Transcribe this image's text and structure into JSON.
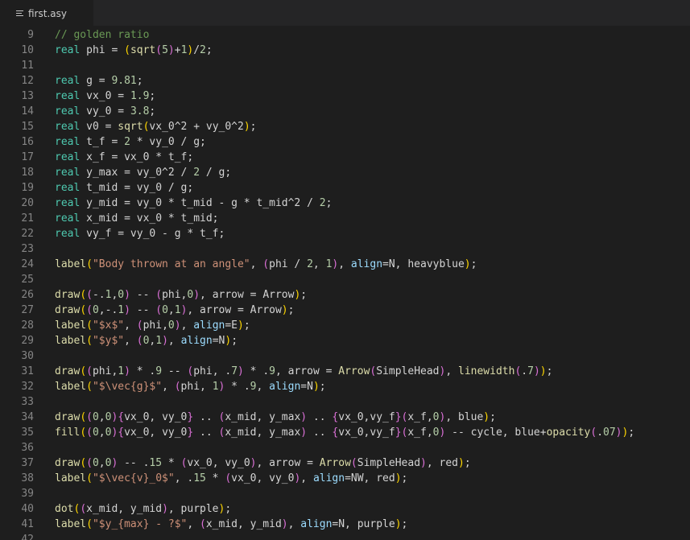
{
  "tab": {
    "filename": "first.asy",
    "icon": "lines-icon"
  },
  "lines": [
    {
      "n": "9",
      "t": [
        [
          "c",
          "// golden ratio"
        ]
      ]
    },
    {
      "n": "10",
      "t": [
        [
          "k",
          "real"
        ],
        [
          "",
          " phi = "
        ],
        [
          "p1",
          "("
        ],
        [
          "f",
          "sqrt"
        ],
        [
          "p2",
          "("
        ],
        [
          "n",
          "5"
        ],
        [
          "p2",
          ")"
        ],
        [
          "",
          "+"
        ],
        [
          "n",
          "1"
        ],
        [
          "p1",
          ")"
        ],
        [
          "",
          "/"
        ],
        [
          "n",
          "2"
        ],
        [
          "",
          ";"
        ]
      ]
    },
    {
      "n": "11",
      "t": []
    },
    {
      "n": "12",
      "t": [
        [
          "k",
          "real"
        ],
        [
          "",
          " g = "
        ],
        [
          "n",
          "9.81"
        ],
        [
          "",
          ";"
        ]
      ]
    },
    {
      "n": "13",
      "t": [
        [
          "k",
          "real"
        ],
        [
          "",
          " vx_0 = "
        ],
        [
          "n",
          "1.9"
        ],
        [
          "",
          ";"
        ]
      ]
    },
    {
      "n": "14",
      "t": [
        [
          "k",
          "real"
        ],
        [
          "",
          " vy_0 = "
        ],
        [
          "n",
          "3.8"
        ],
        [
          "",
          ";"
        ]
      ]
    },
    {
      "n": "15",
      "t": [
        [
          "k",
          "real"
        ],
        [
          "",
          " v0 = "
        ],
        [
          "f",
          "sqrt"
        ],
        [
          "p1",
          "("
        ],
        [
          "",
          "vx_0^2 + vy_0^2"
        ],
        [
          "p1",
          ")"
        ],
        [
          "",
          ";"
        ]
      ]
    },
    {
      "n": "16",
      "t": [
        [
          "k",
          "real"
        ],
        [
          "",
          " t_f = "
        ],
        [
          "n",
          "2"
        ],
        [
          "",
          " * vy_0 / g;"
        ]
      ]
    },
    {
      "n": "17",
      "t": [
        [
          "k",
          "real"
        ],
        [
          "",
          " x_f = vx_0 * t_f;"
        ]
      ]
    },
    {
      "n": "18",
      "t": [
        [
          "k",
          "real"
        ],
        [
          "",
          " y_max = vy_0^2 / "
        ],
        [
          "n",
          "2"
        ],
        [
          "",
          " / g;"
        ]
      ]
    },
    {
      "n": "19",
      "t": [
        [
          "k",
          "real"
        ],
        [
          "",
          " t_mid = vy_0 / g;"
        ]
      ]
    },
    {
      "n": "20",
      "t": [
        [
          "k",
          "real"
        ],
        [
          "",
          " y_mid = vy_0 * t_mid - g * t_mid^2 / "
        ],
        [
          "n",
          "2"
        ],
        [
          "",
          ";"
        ]
      ]
    },
    {
      "n": "21",
      "t": [
        [
          "k",
          "real"
        ],
        [
          "",
          " x_mid = vx_0 * t_mid;"
        ]
      ]
    },
    {
      "n": "22",
      "t": [
        [
          "k",
          "real"
        ],
        [
          "",
          " vy_f = vy_0 - g * t_f;"
        ]
      ]
    },
    {
      "n": "23",
      "t": []
    },
    {
      "n": "24",
      "t": [
        [
          "f",
          "label"
        ],
        [
          "p1",
          "("
        ],
        [
          "s",
          "\"Body thrown at an angle\""
        ],
        [
          "",
          ", "
        ],
        [
          "p2",
          "("
        ],
        [
          "",
          "phi / "
        ],
        [
          "n",
          "2"
        ],
        [
          "",
          ", "
        ],
        [
          "n",
          "1"
        ],
        [
          "p2",
          ")"
        ],
        [
          "",
          ", "
        ],
        [
          "a",
          "align"
        ],
        [
          "",
          "=N, heavyblue"
        ],
        [
          "p1",
          ")"
        ],
        [
          "",
          ";"
        ]
      ]
    },
    {
      "n": "25",
      "t": []
    },
    {
      "n": "26",
      "t": [
        [
          "f",
          "draw"
        ],
        [
          "p1",
          "("
        ],
        [
          "p2",
          "("
        ],
        [
          "",
          "-."
        ],
        [
          "n",
          "1"
        ],
        [
          "",
          ","
        ],
        [
          "n",
          "0"
        ],
        [
          "p2",
          ")"
        ],
        [
          "",
          " -- "
        ],
        [
          "p2",
          "("
        ],
        [
          "",
          "phi,"
        ],
        [
          "n",
          "0"
        ],
        [
          "p2",
          ")"
        ],
        [
          "",
          ", arrow = Arrow"
        ],
        [
          "p1",
          ")"
        ],
        [
          "",
          ";"
        ]
      ]
    },
    {
      "n": "27",
      "t": [
        [
          "f",
          "draw"
        ],
        [
          "p1",
          "("
        ],
        [
          "p2",
          "("
        ],
        [
          "n",
          "0"
        ],
        [
          "",
          ",-."
        ],
        [
          "n",
          "1"
        ],
        [
          "p2",
          ")"
        ],
        [
          "",
          " -- "
        ],
        [
          "p2",
          "("
        ],
        [
          "n",
          "0"
        ],
        [
          "",
          ","
        ],
        [
          "n",
          "1"
        ],
        [
          "p2",
          ")"
        ],
        [
          "",
          ", arrow = Arrow"
        ],
        [
          "p1",
          ")"
        ],
        [
          "",
          ";"
        ]
      ]
    },
    {
      "n": "28",
      "t": [
        [
          "f",
          "label"
        ],
        [
          "p1",
          "("
        ],
        [
          "s",
          "\"$x$\""
        ],
        [
          "",
          ", "
        ],
        [
          "p2",
          "("
        ],
        [
          "",
          "phi,"
        ],
        [
          "n",
          "0"
        ],
        [
          "p2",
          ")"
        ],
        [
          "",
          ", "
        ],
        [
          "a",
          "align"
        ],
        [
          "",
          "=E"
        ],
        [
          "p1",
          ")"
        ],
        [
          "",
          ";"
        ]
      ]
    },
    {
      "n": "29",
      "t": [
        [
          "f",
          "label"
        ],
        [
          "p1",
          "("
        ],
        [
          "s",
          "\"$y$\""
        ],
        [
          "",
          ", "
        ],
        [
          "p2",
          "("
        ],
        [
          "n",
          "0"
        ],
        [
          "",
          ","
        ],
        [
          "n",
          "1"
        ],
        [
          "p2",
          ")"
        ],
        [
          "",
          ", "
        ],
        [
          "a",
          "align"
        ],
        [
          "",
          "=N"
        ],
        [
          "p1",
          ")"
        ],
        [
          "",
          ";"
        ]
      ]
    },
    {
      "n": "30",
      "t": []
    },
    {
      "n": "31",
      "t": [
        [
          "f",
          "draw"
        ],
        [
          "p1",
          "("
        ],
        [
          "p2",
          "("
        ],
        [
          "",
          "phi,"
        ],
        [
          "n",
          "1"
        ],
        [
          "p2",
          ")"
        ],
        [
          "",
          " * ."
        ],
        [
          "n",
          "9"
        ],
        [
          "",
          " -- "
        ],
        [
          "p2",
          "("
        ],
        [
          "",
          "phi, ."
        ],
        [
          "n",
          "7"
        ],
        [
          "p2",
          ")"
        ],
        [
          "",
          " * ."
        ],
        [
          "n",
          "9"
        ],
        [
          "",
          ", arrow = "
        ],
        [
          "f",
          "Arrow"
        ],
        [
          "p2",
          "("
        ],
        [
          "",
          "SimpleHead"
        ],
        [
          "p2",
          ")"
        ],
        [
          "",
          ", "
        ],
        [
          "f",
          "linewidth"
        ],
        [
          "p2",
          "("
        ],
        [
          "",
          "."
        ],
        [
          "n",
          "7"
        ],
        [
          "p2",
          ")"
        ],
        [
          "p1",
          ")"
        ],
        [
          "",
          ";"
        ]
      ]
    },
    {
      "n": "32",
      "t": [
        [
          "f",
          "label"
        ],
        [
          "p1",
          "("
        ],
        [
          "s",
          "\"$\\vec{g}$\""
        ],
        [
          "",
          ", "
        ],
        [
          "p2",
          "("
        ],
        [
          "",
          "phi, "
        ],
        [
          "n",
          "1"
        ],
        [
          "p2",
          ")"
        ],
        [
          "",
          " * ."
        ],
        [
          "n",
          "9"
        ],
        [
          "",
          ", "
        ],
        [
          "a",
          "align"
        ],
        [
          "",
          "=N"
        ],
        [
          "p1",
          ")"
        ],
        [
          "",
          ";"
        ]
      ]
    },
    {
      "n": "33",
      "t": []
    },
    {
      "n": "34",
      "t": [
        [
          "f",
          "draw"
        ],
        [
          "p1",
          "("
        ],
        [
          "p2",
          "("
        ],
        [
          "n",
          "0"
        ],
        [
          "",
          ","
        ],
        [
          "n",
          "0"
        ],
        [
          "p2",
          ")"
        ],
        [
          "p2",
          "{"
        ],
        [
          "",
          "vx_0, vy_0"
        ],
        [
          "p2",
          "}"
        ],
        [
          "",
          " .. "
        ],
        [
          "p2",
          "("
        ],
        [
          "",
          "x_mid, y_max"
        ],
        [
          "p2",
          ")"
        ],
        [
          "",
          " .. "
        ],
        [
          "p2",
          "{"
        ],
        [
          "",
          "vx_0,vy_f"
        ],
        [
          "p2",
          "}"
        ],
        [
          "p2",
          "("
        ],
        [
          "",
          "x_f,"
        ],
        [
          "n",
          "0"
        ],
        [
          "p2",
          ")"
        ],
        [
          "",
          ", blue"
        ],
        [
          "p1",
          ")"
        ],
        [
          "",
          ";"
        ]
      ]
    },
    {
      "n": "35",
      "t": [
        [
          "f",
          "fill"
        ],
        [
          "p1",
          "("
        ],
        [
          "p2",
          "("
        ],
        [
          "n",
          "0"
        ],
        [
          "",
          ","
        ],
        [
          "n",
          "0"
        ],
        [
          "p2",
          ")"
        ],
        [
          "p2",
          "{"
        ],
        [
          "",
          "vx_0, vy_0"
        ],
        [
          "p2",
          "}"
        ],
        [
          "",
          " .. "
        ],
        [
          "p2",
          "("
        ],
        [
          "",
          "x_mid, y_max"
        ],
        [
          "p2",
          ")"
        ],
        [
          "",
          " .. "
        ],
        [
          "p2",
          "{"
        ],
        [
          "",
          "vx_0,vy_f"
        ],
        [
          "p2",
          "}"
        ],
        [
          "p2",
          "("
        ],
        [
          "",
          "x_f,"
        ],
        [
          "n",
          "0"
        ],
        [
          "p2",
          ")"
        ],
        [
          "",
          " -- cycle, blue+"
        ],
        [
          "f",
          "opacity"
        ],
        [
          "p2",
          "("
        ],
        [
          "",
          "."
        ],
        [
          "n",
          "07"
        ],
        [
          "p2",
          ")"
        ],
        [
          "p1",
          ")"
        ],
        [
          "",
          ";"
        ]
      ]
    },
    {
      "n": "36",
      "t": []
    },
    {
      "n": "37",
      "t": [
        [
          "f",
          "draw"
        ],
        [
          "p1",
          "("
        ],
        [
          "p2",
          "("
        ],
        [
          "n",
          "0"
        ],
        [
          "",
          ","
        ],
        [
          "n",
          "0"
        ],
        [
          "p2",
          ")"
        ],
        [
          "",
          " -- ."
        ],
        [
          "n",
          "15"
        ],
        [
          "",
          " * "
        ],
        [
          "p2",
          "("
        ],
        [
          "",
          "vx_0, vy_0"
        ],
        [
          "p2",
          ")"
        ],
        [
          "",
          ", arrow = "
        ],
        [
          "f",
          "Arrow"
        ],
        [
          "p2",
          "("
        ],
        [
          "",
          "SimpleHead"
        ],
        [
          "p2",
          ")"
        ],
        [
          "",
          ", red"
        ],
        [
          "p1",
          ")"
        ],
        [
          "",
          ";"
        ]
      ]
    },
    {
      "n": "38",
      "t": [
        [
          "f",
          "label"
        ],
        [
          "p1",
          "("
        ],
        [
          "s",
          "\"$\\vec{v}_0$\""
        ],
        [
          "",
          ", ."
        ],
        [
          "n",
          "15"
        ],
        [
          "",
          " * "
        ],
        [
          "p2",
          "("
        ],
        [
          "",
          "vx_0, vy_0"
        ],
        [
          "p2",
          ")"
        ],
        [
          "",
          ", "
        ],
        [
          "a",
          "align"
        ],
        [
          "",
          "=NW, red"
        ],
        [
          "p1",
          ")"
        ],
        [
          "",
          ";"
        ]
      ]
    },
    {
      "n": "39",
      "t": []
    },
    {
      "n": "40",
      "t": [
        [
          "f",
          "dot"
        ],
        [
          "p1",
          "("
        ],
        [
          "p2",
          "("
        ],
        [
          "",
          "x_mid, y_mid"
        ],
        [
          "p2",
          ")"
        ],
        [
          "",
          ", purple"
        ],
        [
          "p1",
          ")"
        ],
        [
          "",
          ";"
        ]
      ]
    },
    {
      "n": "41",
      "t": [
        [
          "f",
          "label"
        ],
        [
          "p1",
          "("
        ],
        [
          "s",
          "\"$y_{max} - ?$\""
        ],
        [
          "",
          ", "
        ],
        [
          "p2",
          "("
        ],
        [
          "",
          "x_mid, y_mid"
        ],
        [
          "p2",
          ")"
        ],
        [
          "",
          ", "
        ],
        [
          "a",
          "align"
        ],
        [
          "",
          "=N, purple"
        ],
        [
          "p1",
          ")"
        ],
        [
          "",
          ";"
        ]
      ]
    },
    {
      "n": "42",
      "t": []
    }
  ]
}
